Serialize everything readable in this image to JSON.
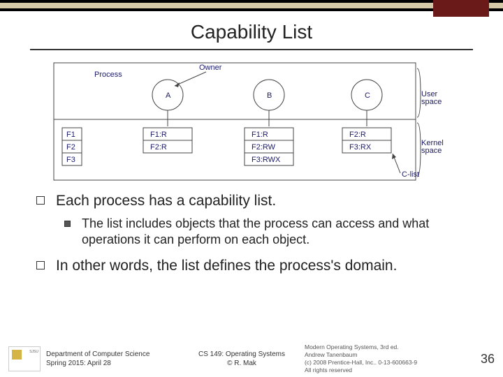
{
  "title": "Capability List",
  "diagram": {
    "owner_label": "Owner",
    "process_label": "Process",
    "processes": [
      "A",
      "B",
      "C"
    ],
    "user_space": "User space",
    "kernel_space": "Kernel space",
    "clist_label": "C-list",
    "files": [
      "F1",
      "F2",
      "F3"
    ],
    "caps": {
      "A": [
        "F1:R",
        "F2:R"
      ],
      "B": [
        "F1:R",
        "F2:RW",
        "F3:RWX"
      ],
      "C": [
        "F2:R",
        "F3:RX"
      ]
    }
  },
  "bullets": {
    "b1": "Each process has a capability list.",
    "b1_sub": "The list includes objects that the process can access and what operations it can perform on each object.",
    "b2": "In other words, the list defines the process's domain."
  },
  "footer": {
    "dept1": "Department of Computer Science",
    "dept2": "Spring 2015: April 28",
    "course": "CS 149: Operating Systems",
    "author": "© R. Mak",
    "ref1": "Modern Operating Systems, 3rd ed.",
    "ref2": "Andrew Tanenbaum",
    "ref3": "(c) 2008 Prentice-Hall, Inc.. 0-13-600663-9",
    "ref4": "All rights reserved",
    "page": "36"
  }
}
